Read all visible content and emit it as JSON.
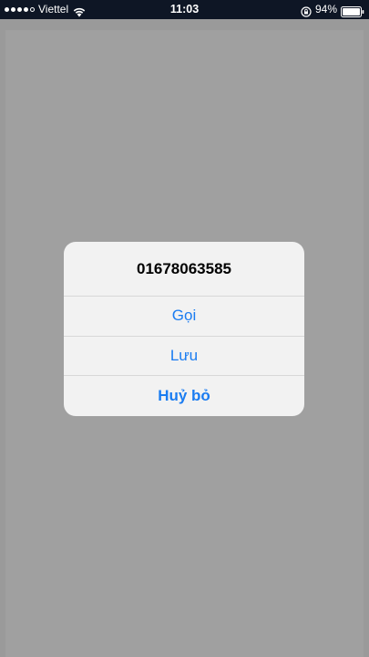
{
  "status_bar": {
    "carrier": "Viettel",
    "time": "11:03",
    "battery_percent": "94%",
    "signal_bars_filled": 4,
    "signal_bars_total": 5
  },
  "alert": {
    "title": "01678063585",
    "actions": [
      {
        "label": "Gọi",
        "style": "default"
      },
      {
        "label": "Lưu",
        "style": "default"
      },
      {
        "label": "Huỷ bỏ",
        "style": "cancel"
      }
    ]
  },
  "colors": {
    "accent": "#1a7cf1",
    "status_bar_bg": "#0e1625",
    "overlay": "#9a9a9a",
    "alert_bg": "#f2f2f2"
  },
  "icons": [
    "wifi-icon",
    "orientation-lock-icon",
    "battery-icon"
  ]
}
